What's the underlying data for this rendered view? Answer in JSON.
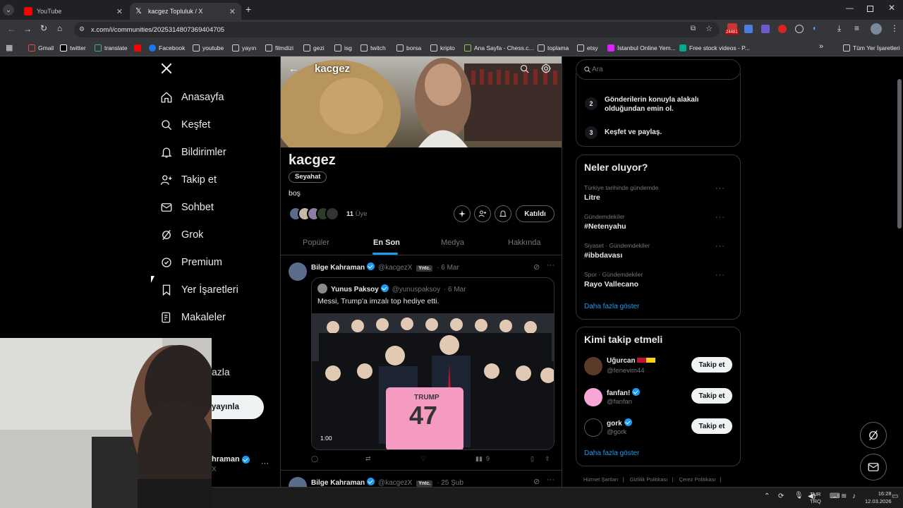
{
  "browser": {
    "tabs": [
      {
        "title": "YouTube"
      },
      {
        "title": "kacgez Topluluk / X"
      }
    ],
    "url": "x.com/i/communities/2025314807369404705",
    "ext_badge": "24481",
    "bookmarks": [
      "Gmail",
      "twitter",
      "translate",
      "Facebook",
      "youtube",
      "yayın",
      "filmdizi",
      "gezi",
      "isg",
      "twitch",
      "borsa",
      "kripto",
      "Ana Sayfa - Chess.c...",
      "toplama",
      "etsy",
      "İstanbul Online Yem...",
      "Free stock videos - P..."
    ],
    "all_bookmarks": "Tüm Yer İşaretleri"
  },
  "nav": {
    "items": [
      "Anasayfa",
      "Keşfet",
      "Bildirimler",
      "Takip et",
      "Sohbet",
      "Grok",
      "Premium",
      "Yer İşaretleri",
      "Makaleler"
    ],
    "more_partial": "azla",
    "post_partial": "yayınla",
    "user_partial": "hraman",
    "user_handle_partial": "X",
    "user_more": "···"
  },
  "header": {
    "title": "kacgez"
  },
  "community": {
    "name": "kacgez",
    "tag": "Seyahat",
    "description": "boş",
    "member_count": "11",
    "member_label": "Üye",
    "join_label": "Katıldı"
  },
  "tabs": [
    "Popüler",
    "En Son",
    "Medya",
    "Hakkında"
  ],
  "active_tab_index": 1,
  "post": {
    "author": "Bilge Kahraman",
    "handle": "@kacgezX",
    "badge": "Yntc.",
    "date": "· 6 Mar",
    "quoted": {
      "author": "Yunus Paksoy",
      "handle": "@yunuspaksoy",
      "date": "· 6 Mar",
      "text": "Messi, Trump'a imzalı top hediye etti.",
      "duration": "1:00",
      "jersey_name": "TRUMP",
      "jersey_number": "47"
    },
    "views": "9"
  },
  "post2": {
    "author": "Bilge Kahraman",
    "handle": "@kacgezX",
    "badge": "Yntc.",
    "date": "· 25 Şub"
  },
  "search": {
    "placeholder": "Ara"
  },
  "rules": [
    {
      "num": "2",
      "text": "Gönderilerin konuyla alakalı olduğundan emin ol."
    },
    {
      "num": "3",
      "text": "Keşfet ve paylaş."
    }
  ],
  "trends": {
    "title": "Neler oluyor?",
    "items": [
      {
        "sub": "Türkiye tarihinde gündemde",
        "title": "Litre"
      },
      {
        "sub": "Gündemdekiler",
        "title": "#Netenyahu"
      },
      {
        "sub": "Siyaset · Gündemdekiler",
        "title": "#ibbdavası"
      },
      {
        "sub": "Spor · Gündemdekiler",
        "title": "Rayo Vallecano"
      }
    ],
    "show_more": "Daha fazla göster"
  },
  "who_to_follow": {
    "title": "Kimi takip etmeli",
    "items": [
      {
        "name": "Uğurcan",
        "handle": "@fenevim44",
        "button": "Takip et"
      },
      {
        "name": "fanfan!",
        "handle": "@fanfan",
        "button": "Takip et"
      },
      {
        "name": "gork",
        "handle": "@gork",
        "button": "Takip et"
      }
    ],
    "show_more": "Daha fazla göster"
  },
  "footer": [
    "Hizmet Şartları",
    "Gizlilik Politikası",
    "Çerez Politikası"
  ],
  "taskbar": {
    "lang1": "TUR",
    "lang2": "TRQ",
    "time": "16:28",
    "date": "12.03.2026"
  },
  "colors": {
    "accent": "#1d9bf0",
    "bg": "#000000",
    "border": "#2f3336",
    "muted": "#71767b"
  }
}
